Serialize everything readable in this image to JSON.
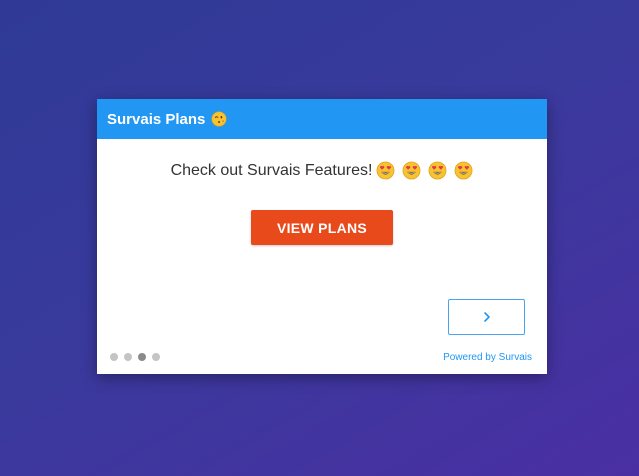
{
  "card": {
    "title": "Survais Plans",
    "title_emoji": "winking-face-kiss-icon",
    "question": "Check out Survais Features!",
    "question_emojis": [
      "heart-eyes-icon",
      "heart-eyes-icon",
      "heart-eyes-icon",
      "heart-eyes-icon"
    ],
    "cta_label": "VIEW PLANS",
    "next_icon": "chevron-right-icon",
    "powered_by": "Powered by Survais",
    "pagination": {
      "total": 4,
      "active_index": 2
    }
  },
  "colors": {
    "header": "#2196f3",
    "cta": "#e84a1b",
    "link": "#2196f3",
    "background_start": "#2f3a96",
    "background_end": "#4a2fa3"
  }
}
